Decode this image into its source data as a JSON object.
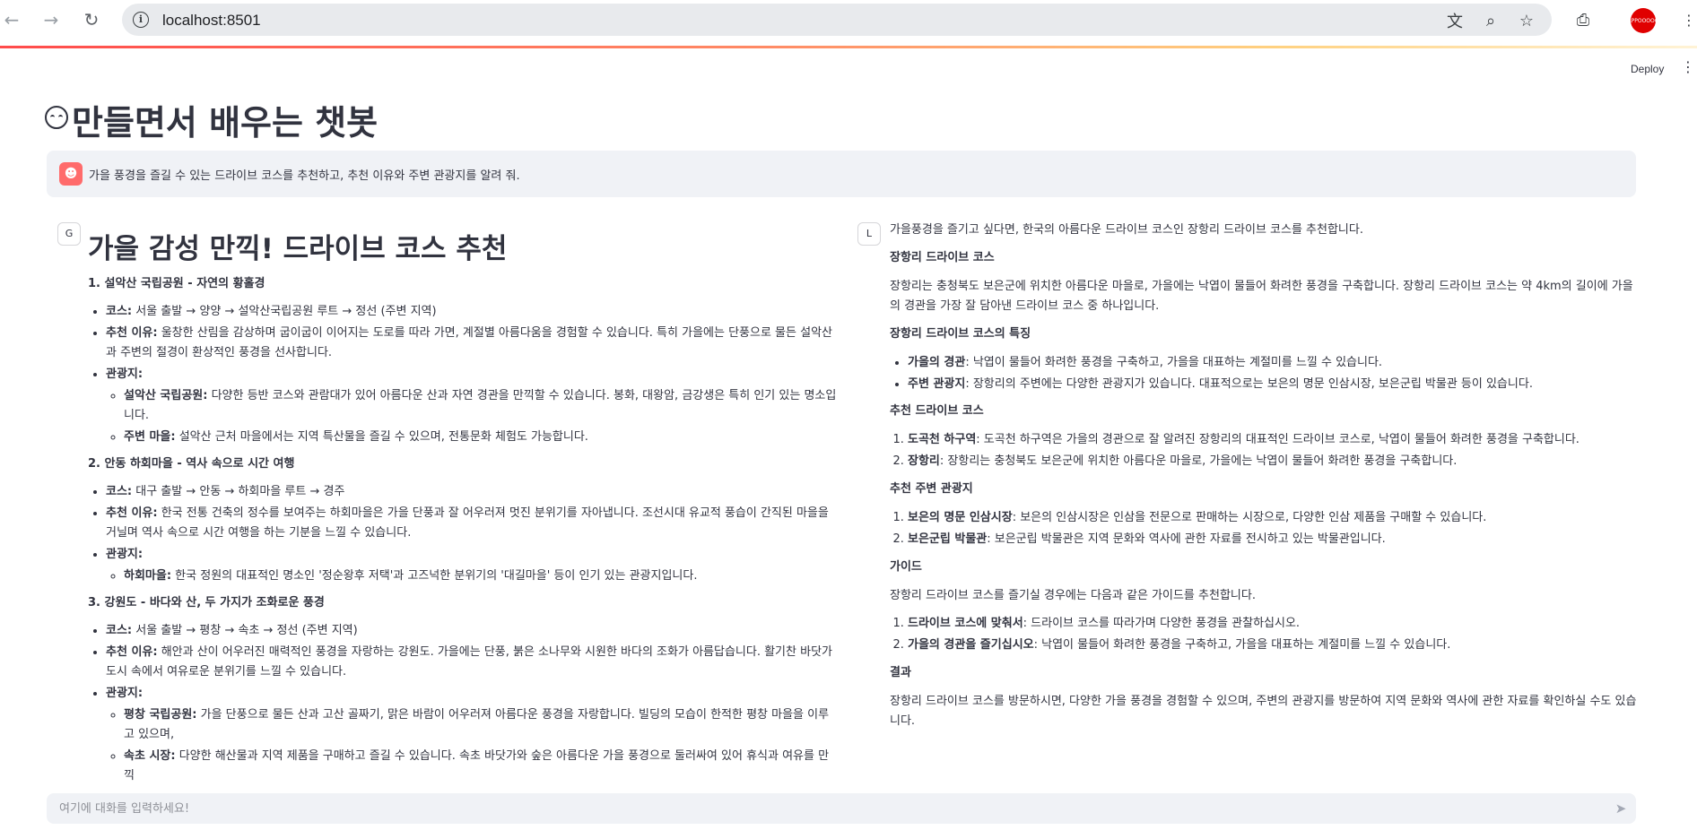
{
  "browser": {
    "url": "localhost:8501",
    "profile_label": "APPOOOOO"
  },
  "header": {
    "deploy_label": "Deploy"
  },
  "app": {
    "title": "만들면서 배우는 챗봇"
  },
  "user_message": {
    "avatar": "user-avatar-icon",
    "text": "가을 풍경을 즐길 수 있는 드라이브 코스를 추천하고, 추천 이유와 주변 관광지를 알려 줘."
  },
  "left_response": {
    "avatar_label": "G",
    "title": "가을 감성 만끽! 드라이브 코스 추천",
    "sections": [
      {
        "heading": "1. 설악산 국립공원 - 자연의 황홀경",
        "course_label": "코스:",
        "course_text": " 서울 출발 → 양양 → 설악산국립공원 루트 → 정선 (주변 지역)",
        "reason_label": "추천 이유:",
        "reason_text": " 울창한 산림을 감상하며 굽이굽이 이어지는 도로를 따라 가면, 계절별 아름다움을 경험할 수 있습니다. 특히 가을에는 단풍으로 물든 설악산과 주변의 절경이 환상적인 풍경을 선사합니다.",
        "spots_label": "관광지:",
        "spots": [
          {
            "name": "설악산 국립공원:",
            "desc": " 다양한 등반 코스와 관람대가 있어 아름다운 산과 자연 경관을 만끽할 수 있습니다. 봉화, 대왕암, 금강생은 특히 인기 있는 명소입니다."
          },
          {
            "name": "주변 마을:",
            "desc": " 설악산 근처 마을에서는 지역 특산물을 즐길 수 있으며, 전통문화 체험도 가능합니다."
          }
        ]
      },
      {
        "heading": "2. 안동 하회마을 - 역사 속으로 시간 여행",
        "course_label": "코스:",
        "course_text": " 대구 출발 → 안동 → 하회마을 루트 → 경주",
        "reason_label": "추천 이유:",
        "reason_text": " 한국 전통 건축의 정수를 보여주는 하회마을은 가을 단풍과 잘 어우러져 멋진 분위기를 자아냅니다. 조선시대 유교적 풍습이 간직된 마을을 거닐며 역사 속으로 시간 여행을 하는 기분을 느낄 수 있습니다.",
        "spots_label": "관광지:",
        "spots": [
          {
            "name": "하회마을:",
            "desc": " 한국 정원의 대표적인 명소인 '정순왕후 저택'과 고즈넉한 분위기의 '대길마을' 등이 인기 있는 관광지입니다."
          }
        ]
      },
      {
        "heading": "3. 강원도 - 바다와 산, 두 가지가 조화로운 풍경",
        "course_label": "코스:",
        "course_text": " 서울 출발 → 평창 → 속초 → 정선 (주변 지역)",
        "reason_label": "추천 이유:",
        "reason_text": " 해안과 산이 어우러진 매력적인 풍경을 자랑하는 강원도. 가을에는 단풍, 붉은 소나무와 시원한 바다의 조화가 아름답습니다. 활기찬 바닷가 도시 속에서 여유로운 분위기를 느낄 수 있습니다.",
        "spots_label": "관광지:",
        "spots": [
          {
            "name": "평창 국립공원:",
            "desc": " 가을 단풍으로 물든 산과 고산 골짜기, 맑은 바람이 어우러져 아름다운 풍경을 자랑합니다. 빌딩의 모습이 한적한 평창 마을을 이루고 있으며,"
          },
          {
            "name": "속초 시장:",
            "desc": " 다양한 해산물과 지역 제품을 구매하고 즐길 수 있습니다. 속초 바닷가와 숲은 아름다운 가을 풍경으로 둘러싸여 있어 휴식과 여유를 만끽"
          }
        ]
      }
    ]
  },
  "right_response": {
    "avatar_label": "L",
    "intro": "가을풍경을 즐기고 싶다면, 한국의 아름다운 드라이브 코스인 장항리 드라이브 코스를 추천합니다.",
    "h_course": "장항리 드라이브 코스",
    "course_desc": "장항리는 충청북도 보은군에 위치한 아름다운 마을로, 가을에는 낙엽이 물들어 화려한 풍경을 구축합니다. 장항리 드라이브 코스는 약 4km의 길이에 가을의 경관을 가장 잘 담아낸 드라이브 코스 중 하나입니다.",
    "h_features": "장항리 드라이브 코스의 특징",
    "features": [
      {
        "label": "가을의 경관",
        "text": ": 낙엽이 물들어 화려한 풍경을 구축하고, 가을을 대표하는 계절미를 느낄 수 있습니다."
      },
      {
        "label": "주변 관광지",
        "text": ": 장항리의 주변에는 다양한 관광지가 있습니다. 대표적으로는 보은의 명문 인삼시장, 보은군립 박물관 등이 있습니다."
      }
    ],
    "h_recommend": "추천 드라이브 코스",
    "recommend": [
      {
        "label": "도곡천 하구역",
        "text": ": 도곡천 하구역은 가을의 경관으로 잘 알려진 장항리의 대표적인 드라이브 코스로, 낙엽이 물들어 화려한 풍경을 구축합니다."
      },
      {
        "label": "장항리",
        "text": ": 장항리는 충청북도 보은군에 위치한 아름다운 마을로, 가을에는 낙엽이 물들어 화려한 풍경을 구축합니다."
      }
    ],
    "h_nearby": "추천 주변 관광지",
    "nearby": [
      {
        "label": "보은의 명문 인삼시장",
        "text": ": 보은의 인삼시장은 인삼을 전문으로 판매하는 시장으로, 다양한 인삼 제품을 구매할 수 있습니다."
      },
      {
        "label": "보은군립 박물관",
        "text": ": 보은군립 박물관은 지역 문화와 역사에 관한 자료를 전시하고 있는 박물관입니다."
      }
    ],
    "h_guide": "가이드",
    "guide_intro": "장항리 드라이브 코스를 즐기실 경우에는 다음과 같은 가이드를 추천합니다.",
    "guide": [
      {
        "label": "드라이브 코스에 맞춰서",
        "text": ": 드라이브 코스를 따라가며 다양한 풍경을 관찰하십시오."
      },
      {
        "label": "가을의 경관을 즐기십시오",
        "text": ": 낙엽이 물들어 화려한 풍경을 구축하고, 가을을 대표하는 계절미를 느낄 수 있습니다."
      }
    ],
    "h_result": "결과",
    "result": "장항리 드라이브 코스를 방문하시면, 다양한 가을 풍경을 경험할 수 있으며, 주변의 관광지를 방문하여 지역 문화와 역사에 관한 자료를 확인하실 수도 있습니다."
  },
  "chat_input": {
    "placeholder": "여기에 대화를 입력하세요!"
  },
  "colors": {
    "accent": "#ff4b4b",
    "user_avatar": "#ff6b6b",
    "message_bg": "#f0f2f6"
  }
}
